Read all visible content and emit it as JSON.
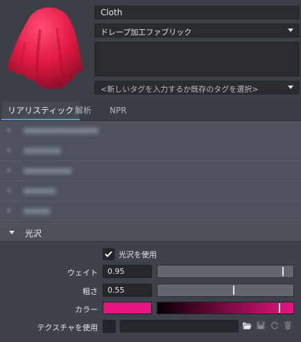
{
  "material": {
    "name": "Cloth",
    "preset": "ドレープ加工ファブリック",
    "description": "",
    "tag_placeholder": "<新しいタグを入力するか既存のタグを選択>"
  },
  "tabs": [
    "リアリスティック",
    "解析",
    "NPR"
  ],
  "active_tab": "リアリスティック",
  "gloss": {
    "title": "光沢",
    "use_label": "光沢を使用",
    "use_checked": true,
    "weight_label": "ウェイト",
    "weight_value": "0.95",
    "weight_fraction": 0.95,
    "roughness_label": "粗さ",
    "roughness_value": "0.55",
    "roughness_fraction": 0.55,
    "color_label": "カラー",
    "color": "#e6157f",
    "color_level": 0.9,
    "texture_label": "テクスチャを使用"
  },
  "colors": {
    "accent": "#4aa3d8",
    "gloss_color": "#e6157f"
  }
}
